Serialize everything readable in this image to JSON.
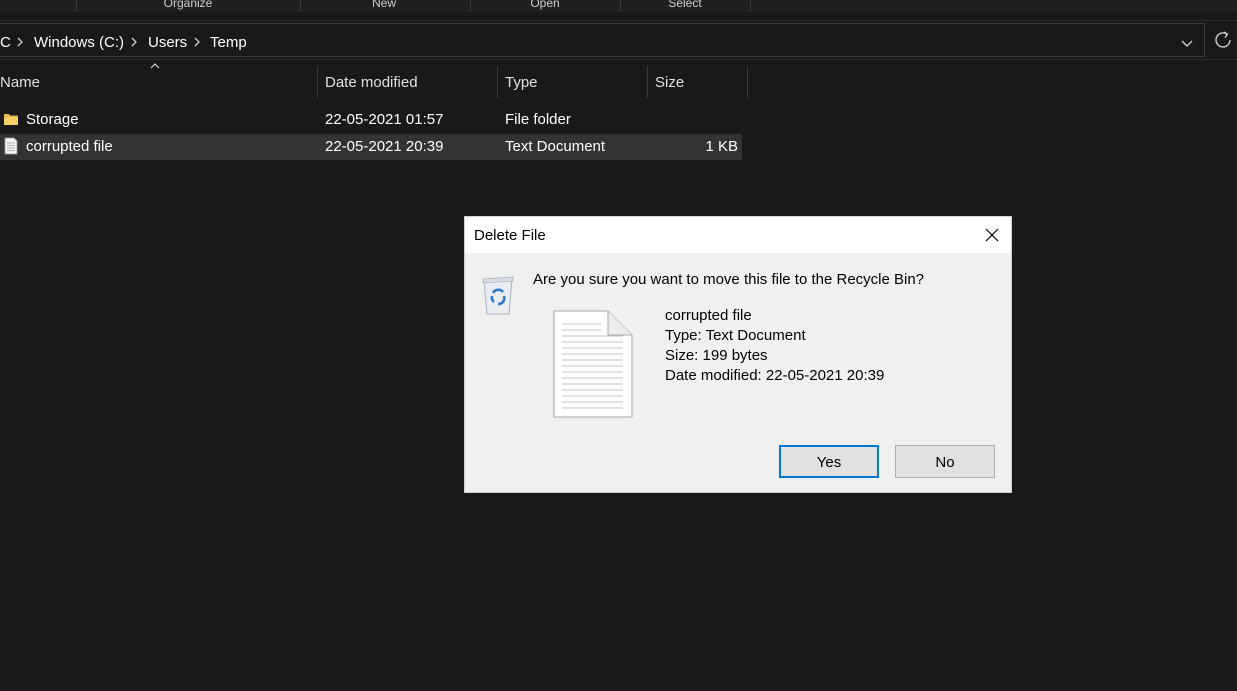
{
  "ribbon": {
    "groups": [
      "Organize",
      "New",
      "Open",
      "Select"
    ]
  },
  "address": {
    "crumbs": [
      "C",
      "Windows (C:)",
      "Users",
      "Temp"
    ]
  },
  "columns": {
    "name": "Name",
    "date_modified": "Date modified",
    "type": "Type",
    "size": "Size"
  },
  "files": [
    {
      "name": "Storage",
      "date": "22-05-2021 01:57",
      "type": "File folder",
      "size": "",
      "icon": "folder-icon"
    },
    {
      "name": "corrupted file",
      "date": "22-05-2021 20:39",
      "type": "Text Document",
      "size": "1 KB",
      "icon": "text-file-icon",
      "selected": true
    }
  ],
  "dialog": {
    "title": "Delete File",
    "question": "Are you sure you want to move this file to the Recycle Bin?",
    "file_name": "corrupted file",
    "file_type": "Type: Text Document",
    "file_size": "Size: 199 bytes",
    "file_date": "Date modified: 22-05-2021 20:39",
    "yes_label": "Yes",
    "no_label": "No"
  },
  "colors": {
    "background": "#191919",
    "selected_row": "#333333",
    "dialog_bg": "#f0f0f0",
    "accent": "#0078d7"
  }
}
